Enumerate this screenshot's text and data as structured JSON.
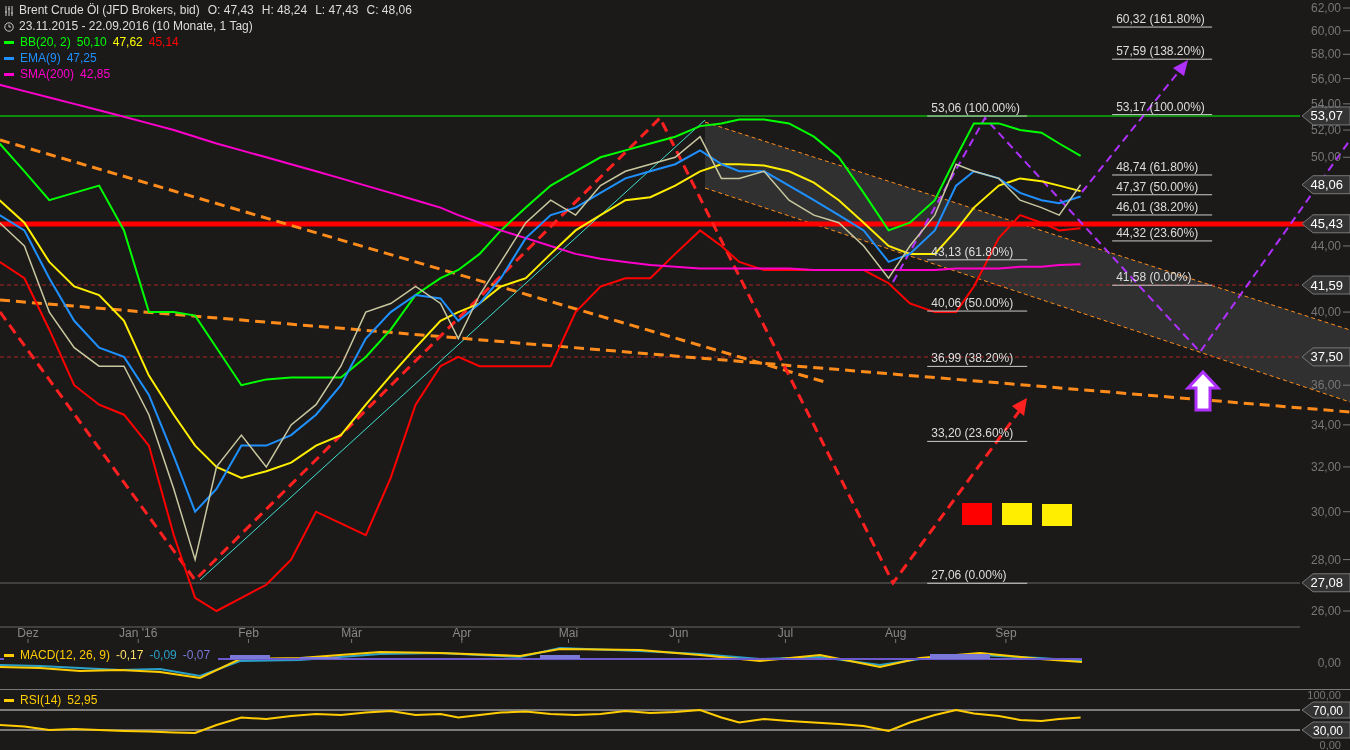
{
  "header": {
    "instrument": "Brent Crude Öl (JFD Brokers, bid)",
    "ohlc": [
      "O: 47,43",
      "H: 48,24",
      "L: 47,43",
      "C: 48,06"
    ],
    "period": "23.11.2015 - 22.09.2016 (10 Monate, 1 Tag)"
  },
  "indicators": [
    {
      "name": "BB(20, 2)",
      "color": "#00ff00",
      "values": [
        {
          "text": "50,10",
          "color": "#00ff00"
        },
        {
          "text": "47,62",
          "color": "#ffff00"
        },
        {
          "text": "45,14",
          "color": "#ff0000"
        }
      ]
    },
    {
      "name": "EMA(9)",
      "color": "#1e90ff",
      "values": [
        {
          "text": "47,25",
          "color": "#1e90ff"
        }
      ]
    },
    {
      "name": "SMA(200)",
      "color": "#ff00cc",
      "values": [
        {
          "text": "42,85",
          "color": "#ff00cc"
        }
      ]
    }
  ],
  "main_chart": {
    "price_axis": [
      "62,00",
      "60,00",
      "58,00",
      "56,00",
      "54,00",
      "52,00",
      "50,00",
      "44,00",
      "40,00",
      "36,00",
      "34,00",
      "32,00",
      "30,00",
      "28,00",
      "26,00"
    ],
    "fib_levels": [
      "60,32 (161.80%)",
      "57,59 (138.20%)",
      "53,06 (100.00%)",
      "53,17 (100.00%)",
      "48,74 (61.80%)",
      "47,37 (50.00%)",
      "46,01 (38.20%)",
      "44,32 (23.60%)",
      "43,13 (61.80%)",
      "41,58 (0.00%)",
      "40,06 (50.00%)",
      "36,99 (38.20%)",
      "33,20 (23.60%)",
      "27,06 (0.00%)"
    ],
    "price_tags": [
      "53,07",
      "48,06",
      "45,43",
      "41,59",
      "37,50",
      "27,08"
    ],
    "date_axis": [
      "Dez",
      "Jan '16",
      "Feb",
      "Mär",
      "Apr",
      "Mai",
      "Jun",
      "Jul",
      "Aug",
      "Sep"
    ]
  },
  "macd": {
    "name": "MACD(12, 26, 9)",
    "color": "#ffcc00",
    "values": [
      {
        "text": "-0,17",
        "color": "#ffdd66"
      },
      {
        "text": "-0,09",
        "color": "#2aa0c8"
      },
      {
        "text": "-0,07",
        "color": "#7a78d8"
      }
    ],
    "axis_label": "0,00"
  },
  "rsi": {
    "name": "RSI(14)",
    "color": "#ffcc00",
    "value": "52,95",
    "axis_labels": [
      "100,00",
      "0,00"
    ],
    "level_tags": [
      "70,00",
      "30,00"
    ]
  }
}
